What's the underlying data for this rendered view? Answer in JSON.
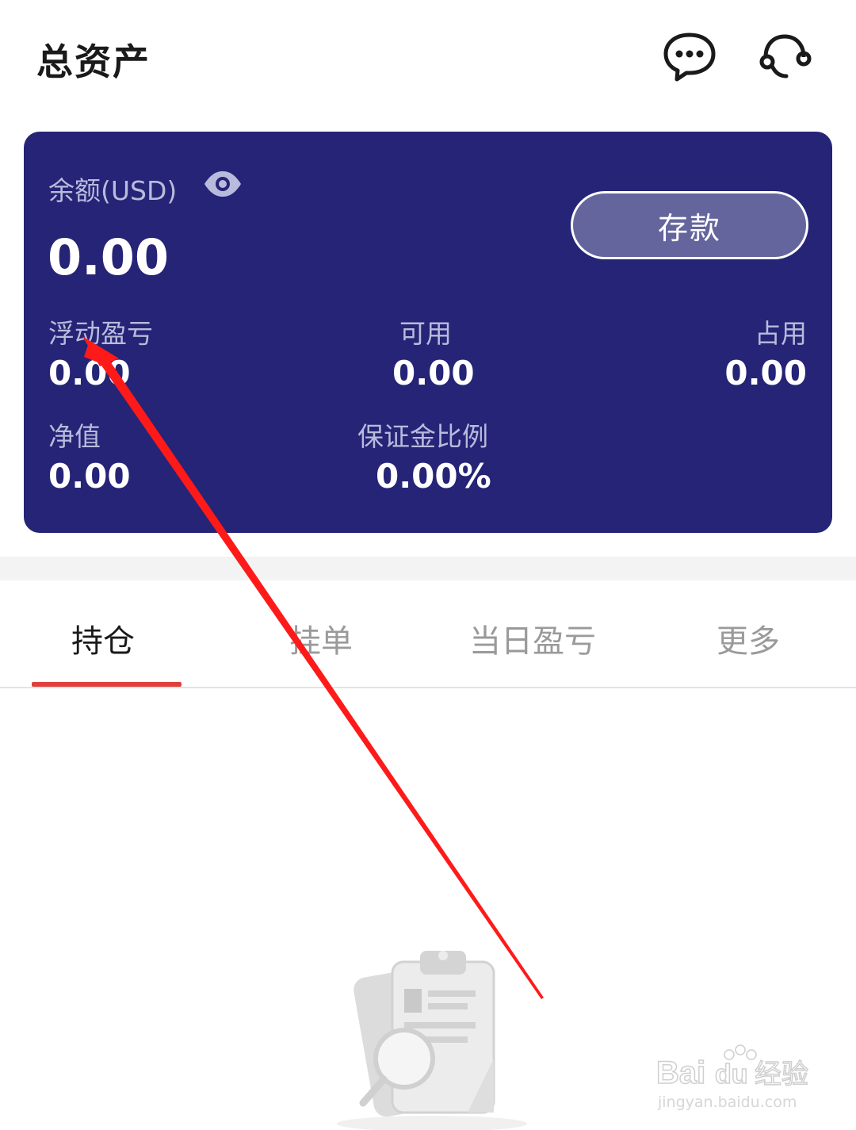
{
  "header": {
    "title": "总资产"
  },
  "account": {
    "balance_label": "余额(USD)",
    "balance_value": "0.00",
    "deposit_label": "存款",
    "stats": {
      "floating_pl_label": "浮动盈亏",
      "floating_pl_value": "0.00",
      "available_label": "可用",
      "available_value": "0.00",
      "used_label": "占用",
      "used_value": "0.00",
      "equity_label": "净值",
      "equity_value": "0.00",
      "margin_ratio_label": "保证金比例",
      "margin_ratio_value": "0.00%"
    }
  },
  "tabs": [
    {
      "label": "持仓",
      "active": true
    },
    {
      "label": "挂单",
      "active": false
    },
    {
      "label": "当日盈亏",
      "active": false
    },
    {
      "label": "更多",
      "active": false
    }
  ],
  "watermark": {
    "brand": "Bai",
    "brand_paw": "du",
    "brand_cn": "经验",
    "url": "jingyan.baidu.com"
  },
  "colors": {
    "card_background": "#252476",
    "tab_indicator": "#e0403c",
    "annotation_arrow": "#ff1a1a"
  },
  "icons": {
    "chat": "chat-bubble-icon",
    "support": "headset-icon",
    "visibility": "eye-icon",
    "empty": "clipboard-search-icon"
  }
}
